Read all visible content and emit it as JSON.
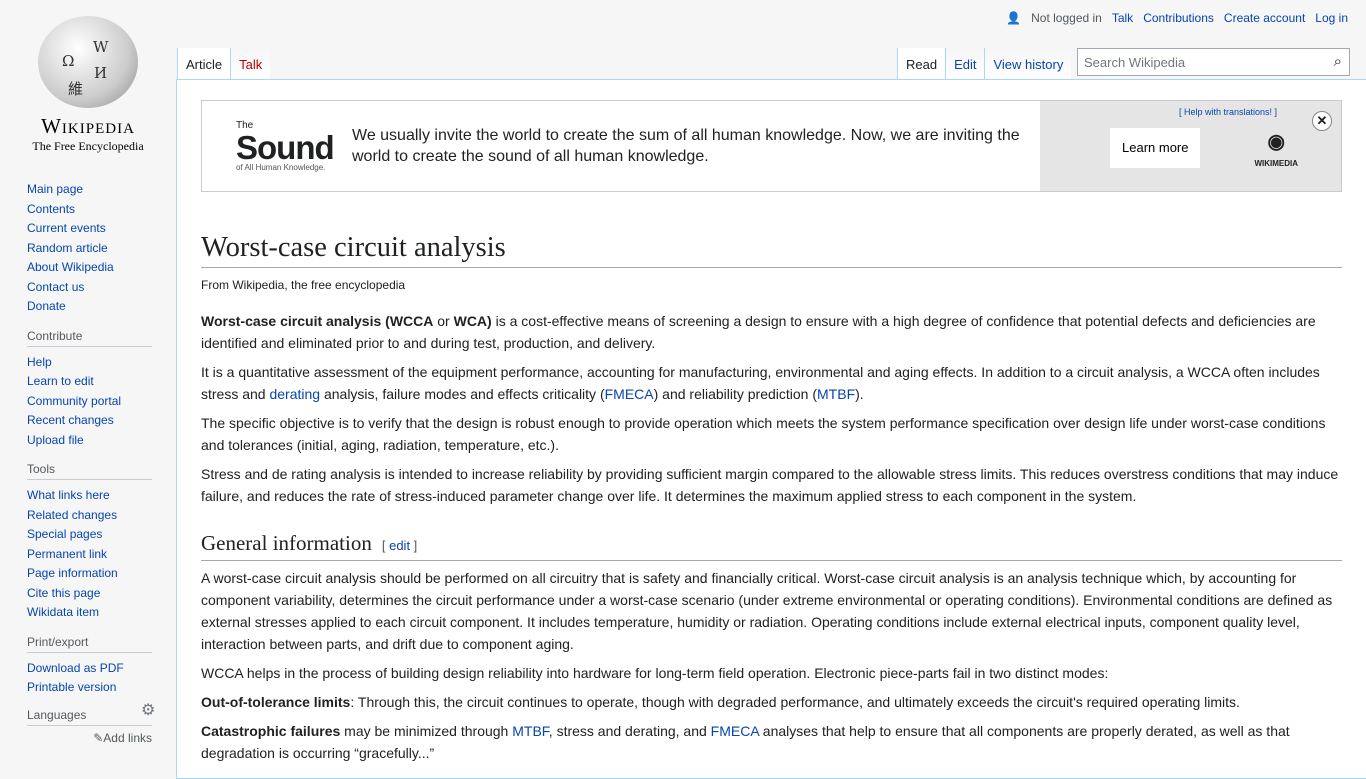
{
  "logo": {
    "wordmark": "Wikipedia",
    "tagline": "The Free Encyclopedia"
  },
  "personal": {
    "not_logged_in": "Not logged in",
    "talk": "Talk",
    "contributions": "Contributions",
    "create_account": "Create account",
    "login": "Log in"
  },
  "tabs_left": [
    "Article",
    "Talk"
  ],
  "tabs_right": [
    "Read",
    "Edit",
    "View history"
  ],
  "search": {
    "placeholder": "Search Wikipedia"
  },
  "sidebar": {
    "nav": [
      "Main page",
      "Contents",
      "Current events",
      "Random article",
      "About Wikipedia",
      "Contact us",
      "Donate"
    ],
    "contribute": {
      "title": "Contribute",
      "items": [
        "Help",
        "Learn to edit",
        "Community portal",
        "Recent changes",
        "Upload file"
      ]
    },
    "tools": {
      "title": "Tools",
      "items": [
        "What links here",
        "Related changes",
        "Special pages",
        "Permanent link",
        "Page information",
        "Cite this page",
        "Wikidata item"
      ]
    },
    "print": {
      "title": "Print/export",
      "items": [
        "Download as PDF",
        "Printable version"
      ]
    },
    "languages": {
      "title": "Languages",
      "add_links": "Add links"
    }
  },
  "banner": {
    "logo_top": "The",
    "logo_main": "Sound",
    "logo_sub": "of All Human Knowledge.",
    "message": "We usually invite the world to create the sum of all human knowledge. Now, we are inviting the world to create the sound of all human knowledge.",
    "help": "[ Help with translations! ]",
    "learn_more": "Learn more",
    "wikimedia": "WIKIMEDIA",
    "close": "✕"
  },
  "article": {
    "title": "Worst-case circuit analysis",
    "from": "From Wikipedia, the free encyclopedia",
    "p1": {
      "b1": "Worst-case circuit analysis (WCCA",
      "t1": " or ",
      "b2": "WCA)",
      "t2": " is a cost-effective means of screening a design to ensure with a high degree of confidence that potential defects and deficiencies are identified and eliminated prior to and during test, production, and delivery."
    },
    "p2": {
      "t1": "It is a quantitative assessment of the equipment performance, accounting for manufacturing, environmental and aging effects. In addition to a circuit analysis, a WCCA often includes stress and ",
      "l1": "derating",
      "t2": " analysis, failure modes and effects criticality (",
      "l2": "FMECA",
      "t3": ") and reliability prediction (",
      "l3": "MTBF",
      "t4": ")."
    },
    "p3": "The specific objective is to verify that the design is robust enough to provide operation which meets the system performance specification over design life under worst-case conditions and tolerances (initial, aging, radiation, temperature, etc.).",
    "p4": "Stress and de rating analysis is intended to increase reliability by providing sufficient margin compared to the allowable stress limits. This reduces overstress conditions that may induce failure, and reduces the rate of stress-induced parameter change over life. It determines the maximum applied stress to each component in the system.",
    "h2": "General information",
    "edit": "edit",
    "p5": "A worst-case circuit analysis should be performed on all circuitry that is safety and financially critical. Worst-case circuit analysis is an analysis technique which, by accounting for component variability, determines the circuit performance under a worst-case scenario (under extreme environmental or operating conditions). Environmental conditions are defined as external stresses applied to each circuit component. It includes temperature, humidity or radiation. Operating conditions include external electrical inputs, component quality level, interaction between parts, and drift due to component aging.",
    "p6": "WCCA helps in the process of building design reliability into hardware for long-term field operation. Electronic piece-parts fail in two distinct modes:",
    "p7": {
      "b": "Out-of-tolerance limits",
      "t": ": Through this, the circuit continues to operate, though with degraded performance, and ultimately exceeds the circuit's required operating limits."
    },
    "p8": {
      "b": "Catastrophic failures",
      "t1": " may be minimized through ",
      "l1": "MTBF",
      "t2": ", stress and derating, and ",
      "l2": "FMECA",
      "t3": " analyses that help to ensure that all components are properly derated, as well as that degradation is occurring “gracefully...”"
    }
  }
}
